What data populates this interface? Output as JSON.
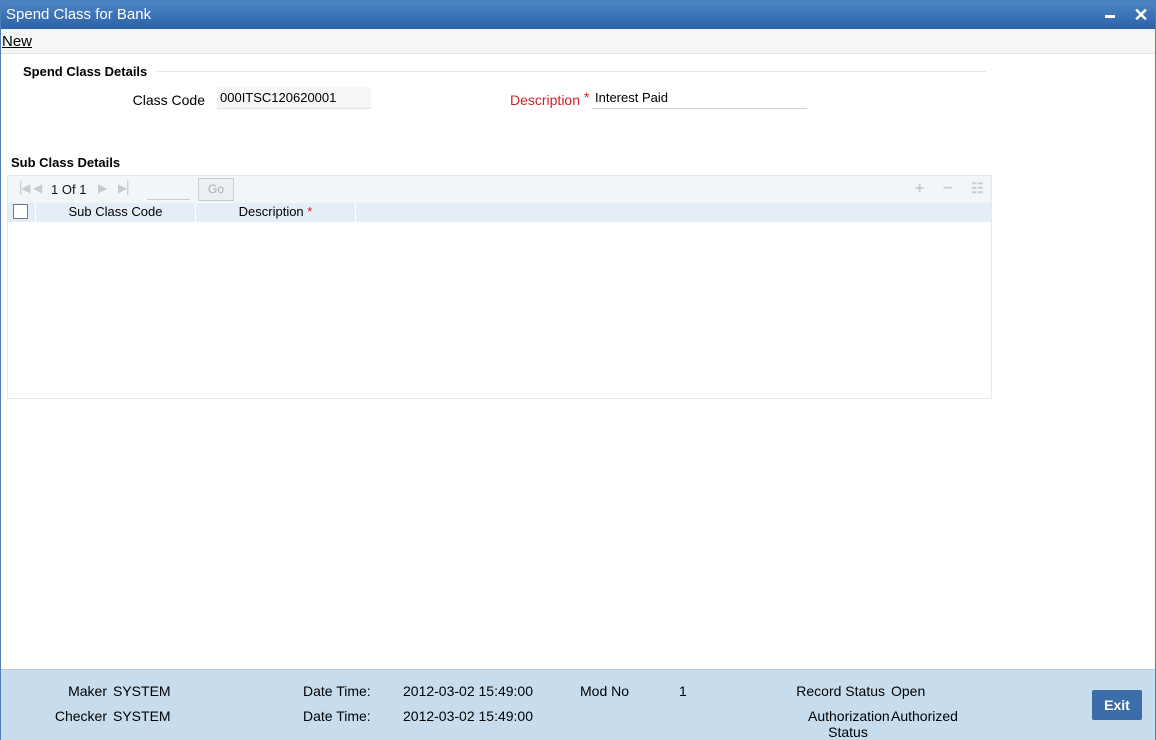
{
  "window": {
    "title": "Spend Class for Bank",
    "minimize_glyph": "",
    "close_glyph": "✕"
  },
  "menu": {
    "new_label": "New"
  },
  "spend_class": {
    "section_title": "Spend Class Details",
    "class_code_label": "Class Code",
    "class_code_value": "000ITSC120620001",
    "description_label": "Description",
    "description_required": "*",
    "description_value": "Interest Paid"
  },
  "sub_class": {
    "section_title": "Sub Class Details",
    "pager": {
      "current": "1",
      "of_label": "Of",
      "total": "1"
    },
    "go_label": "Go",
    "columns": {
      "code": "Sub Class Code",
      "description": "Description",
      "description_required": "*"
    },
    "icons": [
      "first-page-icon",
      "prev-page-icon",
      "next-page-icon",
      "last-page-icon",
      "add-row-icon",
      "delete-row-icon",
      "single-record-view-icon"
    ],
    "rows": []
  },
  "footer": {
    "maker_label": "Maker",
    "maker_value": "SYSTEM",
    "checker_label": "Checker",
    "checker_value": "SYSTEM",
    "date_time_label_1": "Date Time:",
    "date_time_value_1": "2012-03-02 15:49:00",
    "date_time_label_2": "Date Time:",
    "date_time_value_2": "2012-03-02 15:49:00",
    "mod_no_label": "Mod No",
    "mod_no_value": "1",
    "record_status_label": "Record Status",
    "record_status_value": "Open",
    "auth_status_label_1": "Authorization",
    "auth_status_label_2": "Status",
    "auth_status_value": "Authorized",
    "exit_label": "Exit"
  },
  "colors": {
    "titlebar": "#2c62a7",
    "required": "#d0202a",
    "footer": "#c7ddee",
    "exit_button": "#3b6ea8"
  }
}
